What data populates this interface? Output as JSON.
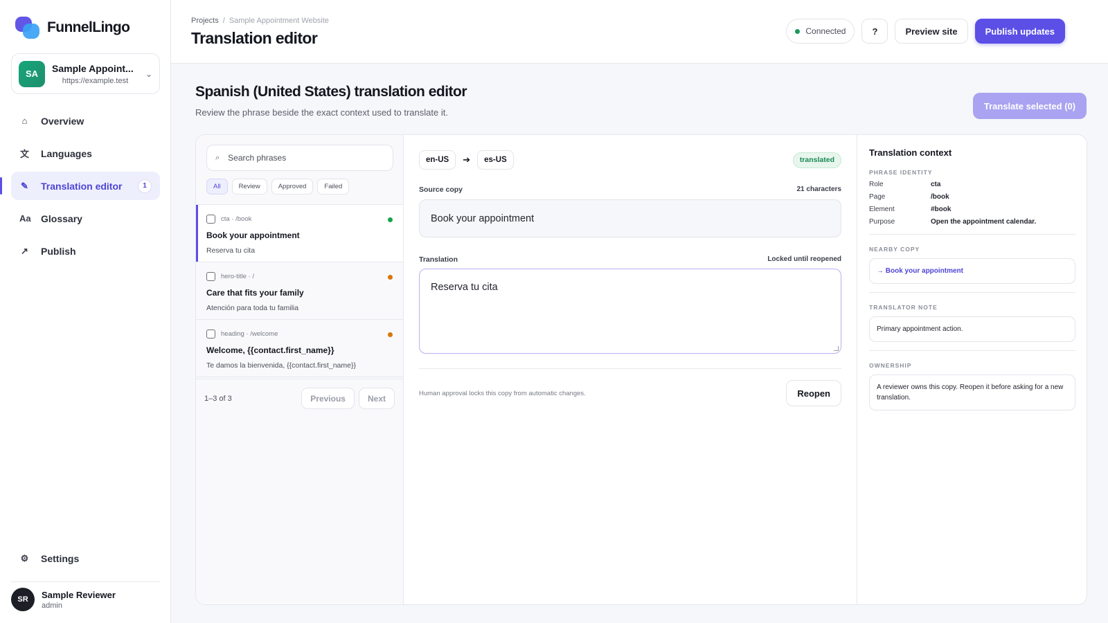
{
  "app": {
    "name": "FunnelLingo"
  },
  "project": {
    "initials": "SA",
    "name": "Sample Appoint...",
    "url": "https://example.test"
  },
  "nav": {
    "items": [
      {
        "label": "Overview",
        "icon": "⌂"
      },
      {
        "label": "Languages",
        "icon": "文"
      },
      {
        "label": "Translation editor",
        "icon": "✎",
        "badge": "1"
      },
      {
        "label": "Glossary",
        "icon": "Aa"
      },
      {
        "label": "Publish",
        "icon": "↗"
      }
    ],
    "settings": {
      "label": "Settings",
      "icon": "⚙"
    }
  },
  "user": {
    "initials": "SR",
    "name": "Sample Reviewer",
    "role": "admin"
  },
  "header": {
    "breadcrumb": [
      "Projects",
      "Sample Appointment Website"
    ],
    "title": "Translation editor",
    "connection": "Connected",
    "help": "?",
    "preview": "Preview site",
    "publish": "Publish updates"
  },
  "editor": {
    "heading": "Spanish (United States) translation editor",
    "subheading": "Review the phrase beside the exact context used to translate it.",
    "translate_selected": "Translate selected (0)"
  },
  "list": {
    "search_placeholder": "Search phrases",
    "filters": [
      "All",
      "Review",
      "Approved",
      "Failed"
    ],
    "phrases": [
      {
        "meta": "cta · /book",
        "source": "Book your appointment",
        "translation": "Reserva tu cita",
        "status_color": "#16a34a"
      },
      {
        "meta": "hero-title · /",
        "source": "Care that fits your family",
        "translation": "Atención para toda tu familia",
        "status_color": "#d97706"
      },
      {
        "meta": "heading · /welcome",
        "source": "Welcome, {{contact.first_name}}",
        "translation": "Te damos la bienvenida, {{contact.first_name}}",
        "status_color": "#d97706"
      }
    ],
    "pager": {
      "range": "1–3 of 3",
      "prev": "Previous",
      "next": "Next"
    }
  },
  "detail": {
    "source_lang": "en-US",
    "target_lang": "es-US",
    "status": "translated",
    "source_label": "Source copy",
    "source_count": "21 characters",
    "source_text": "Book your appointment",
    "translation_label": "Translation",
    "translation_lock": "Locked until reopened",
    "translation_text": "Reserva tu cita",
    "footer_note": "Human approval locks this copy from automatic changes.",
    "reopen": "Reopen"
  },
  "context": {
    "title": "Translation context",
    "identity_heading": "PHRASE IDENTITY",
    "identity": [
      {
        "key": "Role",
        "value": "cta"
      },
      {
        "key": "Page",
        "value": "/book"
      },
      {
        "key": "Element",
        "value": "#book"
      },
      {
        "key": "Purpose",
        "value": "Open the appointment calendar."
      }
    ],
    "nearby_heading": "NEARBY COPY",
    "nearby": "→ Book your appointment",
    "note_heading": "TRANSLATOR NOTE",
    "note": "Primary appointment action.",
    "ownership_heading": "OWNERSHIP",
    "ownership": "A reviewer owns this copy. Reopen it before asking for a new translation."
  },
  "colors": {
    "accent": "#5b4fe6",
    "success": "#16a34a",
    "warning": "#d97706"
  }
}
